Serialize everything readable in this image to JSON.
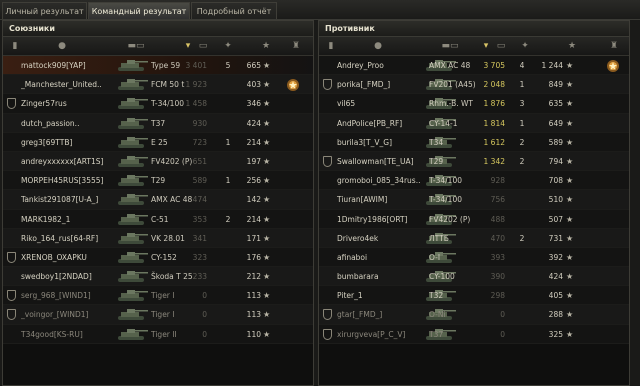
{
  "tabs": [
    {
      "label": "Личный результат"
    },
    {
      "label": "Командный результат"
    },
    {
      "label": "Подробный отчёт"
    }
  ],
  "allies": {
    "title": "Союзники",
    "rows": [
      {
        "name": "mattock909[YAP]",
        "tank": "Type 59",
        "damage": "3 401",
        "kills": "5",
        "xp": "665",
        "medal": false,
        "platoon": false,
        "player": true
      },
      {
        "name": "_Manchester_United..",
        "tank": "FCM 50 t",
        "damage": "1 923",
        "kills": "",
        "xp": "403",
        "medal": true,
        "platoon": false
      },
      {
        "name": "Zinger57rus",
        "tank": "T-34/100",
        "damage": "1 458",
        "kills": "",
        "xp": "346",
        "medal": false,
        "platoon": true
      },
      {
        "name": "dutch_passion..",
        "tank": "T37",
        "damage": "930",
        "kills": "",
        "xp": "424",
        "medal": false,
        "platoon": false
      },
      {
        "name": "greg3[69TTB]",
        "tank": "E 25",
        "damage": "723",
        "kills": "1",
        "xp": "214",
        "medal": false,
        "platoon": false
      },
      {
        "name": "andreyxxxxxx[ART1S]",
        "tank": "FV4202 (P)",
        "damage": "651",
        "kills": "",
        "xp": "197",
        "medal": false,
        "platoon": false
      },
      {
        "name": "MORPEH45RUS[3555]",
        "tank": "T29",
        "damage": "589",
        "kills": "1",
        "xp": "256",
        "medal": false,
        "platoon": false
      },
      {
        "name": "Tankist291087[U-A_]",
        "tank": "AMX AC 48",
        "damage": "474",
        "kills": "",
        "xp": "142",
        "medal": false,
        "platoon": false
      },
      {
        "name": "MARK1982_1",
        "tank": "C-51",
        "damage": "353",
        "kills": "2",
        "xp": "214",
        "medal": false,
        "platoon": false
      },
      {
        "name": "Riko_164_rus[64-RF]",
        "tank": "VK 28.01",
        "damage": "341",
        "kills": "",
        "xp": "171",
        "medal": false,
        "platoon": false
      },
      {
        "name": "XRENOB_OXAPKU",
        "tank": "CY-152",
        "damage": "323",
        "kills": "",
        "xp": "176",
        "medal": false,
        "platoon": true
      },
      {
        "name": "swedboy1[2NDAD]",
        "tank": "Škoda T 25",
        "damage": "233",
        "kills": "",
        "xp": "212",
        "medal": false,
        "platoon": false
      },
      {
        "name": "serg_968_[WIND1]",
        "tank": "Tiger I",
        "damage": "0",
        "kills": "",
        "xp": "113",
        "medal": false,
        "platoon": true
      },
      {
        "name": "_voingor_[WIND1]",
        "tank": "Tiger I",
        "damage": "0",
        "kills": "",
        "xp": "113",
        "medal": false,
        "platoon": true
      },
      {
        "name": "T34good[KS-RU]",
        "tank": "Tiger II",
        "damage": "0",
        "kills": "",
        "xp": "110",
        "medal": false,
        "platoon": false
      }
    ]
  },
  "enemies": {
    "title": "Противник",
    "rows": [
      {
        "name": "Andrey_Proo",
        "tank": "AMX AC 48",
        "damage": "3 705",
        "kills": "4",
        "xp": "1 244",
        "medal": true,
        "platoon": false
      },
      {
        "name": "porika[_FMD_]",
        "tank": "FV201 (A45)",
        "damage": "2 048",
        "kills": "1",
        "xp": "849",
        "medal": false,
        "platoon": true
      },
      {
        "name": "vil65",
        "tank": "Rhm.-B. WT",
        "damage": "1 876",
        "kills": "3",
        "xp": "635",
        "medal": false,
        "platoon": false
      },
      {
        "name": "AndPolice[PB_RF]",
        "tank": "CY-14-1",
        "damage": "1 814",
        "kills": "1",
        "xp": "649",
        "medal": false,
        "platoon": false
      },
      {
        "name": "burila3[T_V_G]",
        "tank": "T34",
        "damage": "1 612",
        "kills": "2",
        "xp": "589",
        "medal": false,
        "platoon": false
      },
      {
        "name": "Swallowman[TE_UA]",
        "tank": "T29",
        "damage": "1 342",
        "kills": "2",
        "xp": "794",
        "medal": false,
        "platoon": true
      },
      {
        "name": "gromoboi_085_34rus..",
        "tank": "T-34/100",
        "damage": "928",
        "kills": "",
        "xp": "708",
        "medal": false,
        "platoon": false
      },
      {
        "name": "Tiuran[AWIM]",
        "tank": "T-34/100",
        "damage": "756",
        "kills": "",
        "xp": "510",
        "medal": false,
        "platoon": false
      },
      {
        "name": "1Dmitry1986[ORT]",
        "tank": "FV4202 (P)",
        "damage": "488",
        "kills": "",
        "xp": "507",
        "medal": false,
        "platoon": false
      },
      {
        "name": "Drivero4ek",
        "tank": "ЛТТБ",
        "damage": "470",
        "kills": "2",
        "xp": "731",
        "medal": false,
        "platoon": false
      },
      {
        "name": "afinaboi",
        "tank": "O-I",
        "damage": "393",
        "kills": "",
        "xp": "392",
        "medal": false,
        "platoon": false
      },
      {
        "name": "bumbarara",
        "tank": "CY-100",
        "damage": "390",
        "kills": "",
        "xp": "424",
        "medal": false,
        "platoon": false
      },
      {
        "name": "Piter_1",
        "tank": "T32",
        "damage": "298",
        "kills": "",
        "xp": "405",
        "medal": false,
        "platoon": false
      },
      {
        "name": "gtar[_FMD_]",
        "tank": "O-Ni",
        "damage": "0",
        "kills": "",
        "xp": "288",
        "medal": false,
        "platoon": true
      },
      {
        "name": "xirurgveva[P_C_V]",
        "tank": "T37",
        "damage": "0",
        "kills": "",
        "xp": "325",
        "medal": false,
        "platoon": true
      }
    ]
  },
  "icons": {
    "platoon": "platoon-icon",
    "player": "player-icon",
    "tank": "tank-icon",
    "damage": "damage-icon",
    "kills": "kills-icon",
    "xp": "xp-star-icon",
    "medal": "medal-icon"
  },
  "colors": {
    "player_row": "#3a1f12",
    "hit_damage": "#d6c85f",
    "text": "#c8c4b4"
  }
}
